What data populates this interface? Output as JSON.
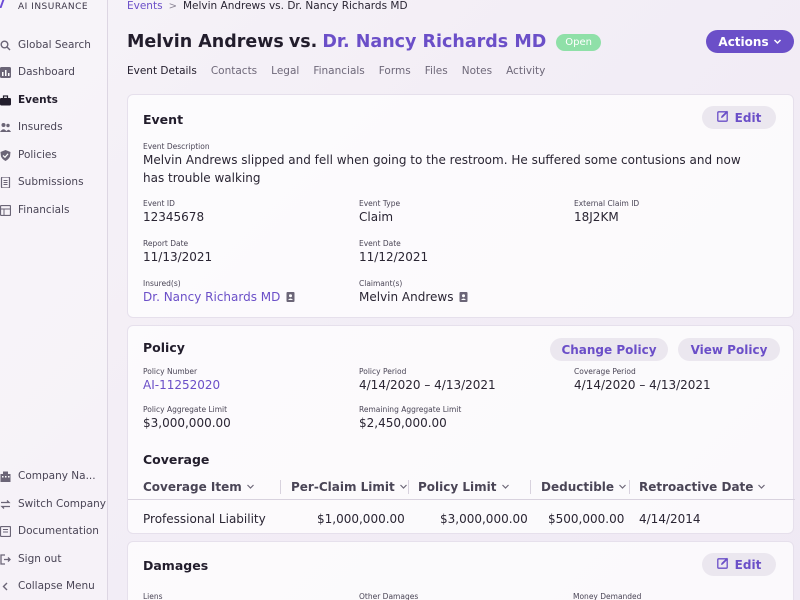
{
  "app": {
    "logo_text": "AI INSURANCE"
  },
  "sidebar": {
    "items": [
      {
        "label": "Global Search"
      },
      {
        "label": "Dashboard"
      },
      {
        "label": "Events"
      },
      {
        "label": "Insureds"
      },
      {
        "label": "Policies"
      },
      {
        "label": "Submissions"
      },
      {
        "label": "Financials"
      }
    ],
    "bottom": [
      {
        "label": "Company Na..."
      },
      {
        "label": "Switch Company"
      },
      {
        "label": "Documentation"
      },
      {
        "label": "Sign out"
      },
      {
        "label": "Collapse Menu"
      }
    ]
  },
  "breadcrumb": {
    "root": "Events",
    "sep": ">",
    "current": "Melvin Andrews vs. Dr. Nancy Richards MD"
  },
  "header": {
    "claimant": "Melvin Andrews",
    "vs": "vs.",
    "insured": "Dr. Nancy Richards MD",
    "status": "Open",
    "actions_label": "Actions"
  },
  "tabs": [
    "Event Details",
    "Contacts",
    "Legal",
    "Financials",
    "Forms",
    "Files",
    "Notes",
    "Activity"
  ],
  "event": {
    "title": "Event",
    "edit_label": "Edit",
    "description_label": "Event Description",
    "description": "Melvin Andrews slipped and fell when going to the restroom. He suffered some contusions and now has trouble walking",
    "event_id_label": "Event ID",
    "event_id": "12345678",
    "event_type_label": "Event Type",
    "event_type": "Claim",
    "external_claim_id_label": "External Claim ID",
    "external_claim_id": "18J2KM",
    "report_date_label": "Report Date",
    "report_date": "11/13/2021",
    "event_date_label": "Event Date",
    "event_date": "11/12/2021",
    "insureds_label": "Insured(s)",
    "insured": "Dr. Nancy Richards MD",
    "claimants_label": "Claimant(s)",
    "claimant": "Melvin Andrews"
  },
  "policy": {
    "title": "Policy",
    "change_label": "Change Policy",
    "view_label": "View Policy",
    "number_label": "Policy Number",
    "number": "AI-11252020",
    "period_label": "Policy Period",
    "period": "4/14/2020 – 4/13/2021",
    "coverage_period_label": "Coverage Period",
    "coverage_period": "4/14/2020 – 4/13/2021",
    "aggregate_label": "Policy Aggregate Limit",
    "aggregate": "$3,000,000.00",
    "remaining_label": "Remaining Aggregate Limit",
    "remaining": "$2,450,000.00"
  },
  "coverage": {
    "title": "Coverage",
    "columns": [
      "Coverage Item",
      "Per-Claim Limit",
      "Policy Limit",
      "Deductible",
      "Retroactive Date"
    ],
    "rows": [
      [
        "Professional Liability",
        "$1,000,000.00",
        "$3,000,000.00",
        "$500,000.00",
        "4/14/2014"
      ]
    ]
  },
  "damages": {
    "title": "Damages",
    "edit_label": "Edit",
    "liens_label": "Liens",
    "other_label": "Other Damages",
    "money_label": "Money Demanded"
  },
  "colors": {
    "accent": "#6b4fc8",
    "status_open": "#8fe0a8"
  }
}
